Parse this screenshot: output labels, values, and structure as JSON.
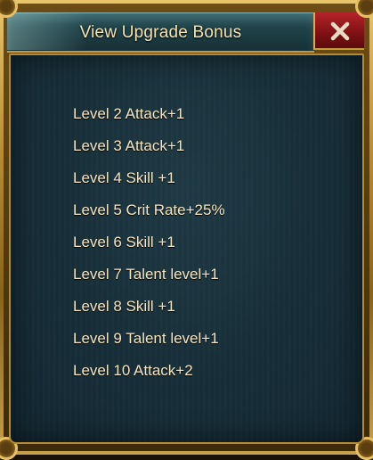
{
  "window": {
    "title": "View Upgrade Bonus",
    "close_icon": "close-x-icon"
  },
  "bonuses": [
    "Level 2 Attack+1",
    "Level 3 Attack+1",
    "Level 4 Skill +1",
    "Level 5 Crit Rate+25%",
    "Level 6 Skill +1",
    "Level 7 Talent level+1",
    "Level 8 Skill +1",
    "Level 9 Talent level+1",
    "Level 10 Attack+2"
  ],
  "colors": {
    "frame_gold": "#c89a3a",
    "header_teal": "#1f4249",
    "close_red": "#9b1a1e",
    "panel_bg": "#18303a",
    "text": "#f4e6c2"
  }
}
